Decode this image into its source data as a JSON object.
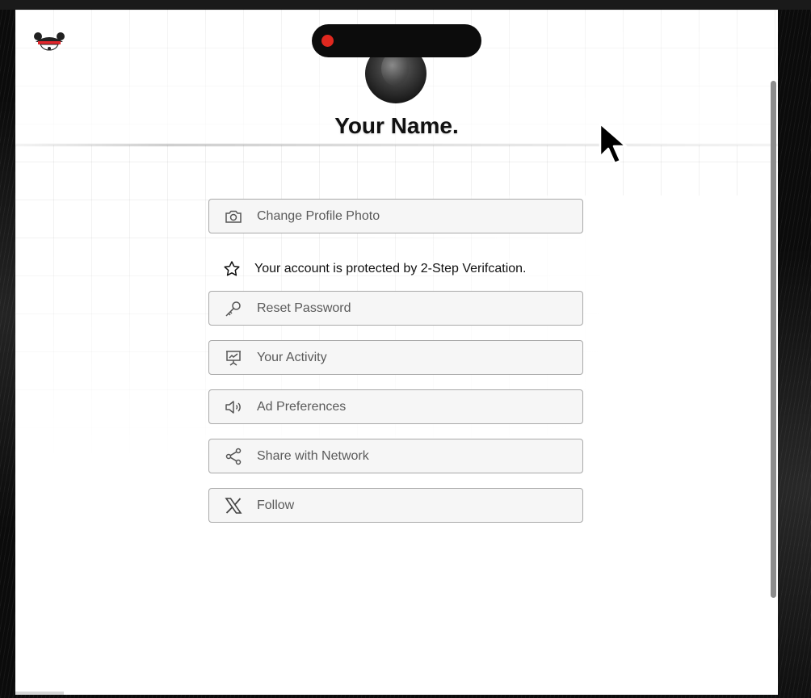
{
  "profile": {
    "name": "Your Name.",
    "avatar": "avatar-photo"
  },
  "recording_indicator": {
    "color": "#e0281f"
  },
  "actions": [
    {
      "key": "change_photo",
      "label": "Change Profile Photo",
      "icon": "camera-icon"
    },
    {
      "key": "reset_password",
      "label": "Reset Password",
      "icon": "key-icon"
    },
    {
      "key": "activity",
      "label": "Your Activity",
      "icon": "activity-chart-icon"
    },
    {
      "key": "ad_prefs",
      "label": "Ad Preferences",
      "icon": "speaker-icon"
    },
    {
      "key": "share",
      "label": "Share with Network",
      "icon": "share-icon"
    },
    {
      "key": "follow",
      "label": "Follow",
      "icon": "x-logo-icon"
    }
  ],
  "security_note": {
    "text": "Your account is protected by 2-Step Verifcation.",
    "icon": "star-icon"
  },
  "colors": {
    "button_border": "#a9a9a9",
    "button_bg": "#f6f6f6",
    "button_text": "#5a5a5a"
  }
}
